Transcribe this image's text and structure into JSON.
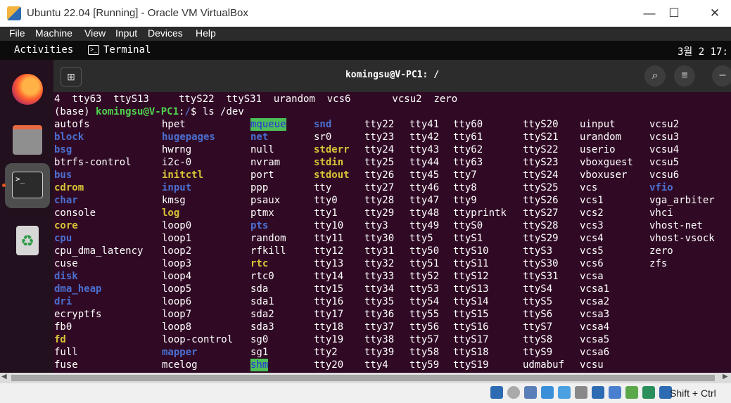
{
  "host_window": {
    "title": "Ubuntu 22.04 [Running] - Oracle VM VirtualBox",
    "controls": {
      "minimize": "—",
      "maximize": "☐",
      "close": "✕"
    },
    "menu": [
      "File",
      "Machine",
      "View",
      "Input",
      "Devices",
      "Help"
    ],
    "host_key": "Shift + Ctrl"
  },
  "ubuntu": {
    "activities": "Activities",
    "app_name": "Terminal",
    "clock": "3월 2 17:",
    "dock": [
      "firefox-icon",
      "files-icon",
      "terminal-icon",
      "trash-icon"
    ]
  },
  "terminal": {
    "title": "komingsu@V-PC1: /",
    "new_tab_glyph": "⊞",
    "search_glyph": "⌕",
    "menu_glyph": "≡",
    "close_glyph": "–",
    "first_line": "4  tty63  ttyS13     ttyS22  ttyS31  urandom  vcs6       vcsu2  zero",
    "prompt": {
      "env": "(base) ",
      "user": "komingsu@V-PC1",
      "sep": ":",
      "path": "/",
      "cmd": "$ ls /dev"
    },
    "columns": [
      [
        [
          "autofs",
          "r"
        ],
        [
          "block",
          "d"
        ],
        [
          "bsg",
          "d"
        ],
        [
          "btrfs-control",
          "r"
        ],
        [
          "bus",
          "d"
        ],
        [
          "cdrom",
          "dev"
        ],
        [
          "char",
          "d"
        ],
        [
          "console",
          "r"
        ],
        [
          "core",
          "dev"
        ],
        [
          "cpu",
          "d"
        ],
        [
          "cpu_dma_latency",
          "r"
        ],
        [
          "cuse",
          "r"
        ],
        [
          "disk",
          "d"
        ],
        [
          "dma_heap",
          "d"
        ],
        [
          "dri",
          "d"
        ],
        [
          "ecryptfs",
          "r"
        ],
        [
          "fb0",
          "r"
        ],
        [
          "fd",
          "dev"
        ],
        [
          "full",
          "r"
        ],
        [
          "fuse",
          "r"
        ]
      ],
      [
        [
          "hpet",
          "r"
        ],
        [
          "hugepages",
          "d"
        ],
        [
          "hwrng",
          "r"
        ],
        [
          "i2c-0",
          "r"
        ],
        [
          "initctl",
          "dev"
        ],
        [
          "input",
          "d"
        ],
        [
          "kmsg",
          "r"
        ],
        [
          "log",
          "dev"
        ],
        [
          "loop0",
          "r"
        ],
        [
          "loop1",
          "r"
        ],
        [
          "loop2",
          "r"
        ],
        [
          "loop3",
          "r"
        ],
        [
          "loop4",
          "r"
        ],
        [
          "loop5",
          "r"
        ],
        [
          "loop6",
          "r"
        ],
        [
          "loop7",
          "r"
        ],
        [
          "loop8",
          "r"
        ],
        [
          "loop-control",
          "r"
        ],
        [
          "mapper",
          "d"
        ],
        [
          "mcelog",
          "r"
        ]
      ],
      [
        [
          "mqueue",
          "hl"
        ],
        [
          "net",
          "d"
        ],
        [
          "null",
          "r"
        ],
        [
          "nvram",
          "r"
        ],
        [
          "port",
          "r"
        ],
        [
          "ppp",
          "r"
        ],
        [
          "psaux",
          "r"
        ],
        [
          "ptmx",
          "r"
        ],
        [
          "pts",
          "d"
        ],
        [
          "random",
          "r"
        ],
        [
          "rfkill",
          "r"
        ],
        [
          "rtc",
          "dev"
        ],
        [
          "rtc0",
          "r"
        ],
        [
          "sda",
          "r"
        ],
        [
          "sda1",
          "r"
        ],
        [
          "sda2",
          "r"
        ],
        [
          "sda3",
          "r"
        ],
        [
          "sg0",
          "r"
        ],
        [
          "sg1",
          "r"
        ],
        [
          "shm",
          "hl"
        ]
      ],
      [
        [
          "snd",
          "d"
        ],
        [
          "sr0",
          "r"
        ],
        [
          "stderr",
          "dev"
        ],
        [
          "stdin",
          "dev"
        ],
        [
          "stdout",
          "dev"
        ],
        [
          "tty",
          "r"
        ],
        [
          "tty0",
          "r"
        ],
        [
          "tty1",
          "r"
        ],
        [
          "tty10",
          "r"
        ],
        [
          "tty11",
          "r"
        ],
        [
          "tty12",
          "r"
        ],
        [
          "tty13",
          "r"
        ],
        [
          "tty14",
          "r"
        ],
        [
          "tty15",
          "r"
        ],
        [
          "tty16",
          "r"
        ],
        [
          "tty17",
          "r"
        ],
        [
          "tty18",
          "r"
        ],
        [
          "tty19",
          "r"
        ],
        [
          "tty2",
          "r"
        ],
        [
          "tty20",
          "r"
        ]
      ],
      [
        [
          "tty22",
          "r"
        ],
        [
          "tty23",
          "r"
        ],
        [
          "tty24",
          "r"
        ],
        [
          "tty25",
          "r"
        ],
        [
          "tty26",
          "r"
        ],
        [
          "tty27",
          "r"
        ],
        [
          "tty28",
          "r"
        ],
        [
          "tty29",
          "r"
        ],
        [
          "tty3",
          "r"
        ],
        [
          "tty30",
          "r"
        ],
        [
          "tty31",
          "r"
        ],
        [
          "tty32",
          "r"
        ],
        [
          "tty33",
          "r"
        ],
        [
          "tty34",
          "r"
        ],
        [
          "tty35",
          "r"
        ],
        [
          "tty36",
          "r"
        ],
        [
          "tty37",
          "r"
        ],
        [
          "tty38",
          "r"
        ],
        [
          "tty39",
          "r"
        ],
        [
          "tty4",
          "r"
        ]
      ],
      [
        [
          "tty41",
          "r"
        ],
        [
          "tty42",
          "r"
        ],
        [
          "tty43",
          "r"
        ],
        [
          "tty44",
          "r"
        ],
        [
          "tty45",
          "r"
        ],
        [
          "tty46",
          "r"
        ],
        [
          "tty47",
          "r"
        ],
        [
          "tty48",
          "r"
        ],
        [
          "tty49",
          "r"
        ],
        [
          "tty5",
          "r"
        ],
        [
          "tty50",
          "r"
        ],
        [
          "tty51",
          "r"
        ],
        [
          "tty52",
          "r"
        ],
        [
          "tty53",
          "r"
        ],
        [
          "tty54",
          "r"
        ],
        [
          "tty55",
          "r"
        ],
        [
          "tty56",
          "r"
        ],
        [
          "tty57",
          "r"
        ],
        [
          "tty58",
          "r"
        ],
        [
          "tty59",
          "r"
        ]
      ],
      [
        [
          "tty60",
          "r"
        ],
        [
          "tty61",
          "r"
        ],
        [
          "tty62",
          "r"
        ],
        [
          "tty63",
          "r"
        ],
        [
          "tty7",
          "r"
        ],
        [
          "tty8",
          "r"
        ],
        [
          "tty9",
          "r"
        ],
        [
          "ttyprintk",
          "r"
        ],
        [
          "ttyS0",
          "r"
        ],
        [
          "ttyS1",
          "r"
        ],
        [
          "ttyS10",
          "r"
        ],
        [
          "ttyS11",
          "r"
        ],
        [
          "ttyS12",
          "r"
        ],
        [
          "ttyS13",
          "r"
        ],
        [
          "ttyS14",
          "r"
        ],
        [
          "ttyS15",
          "r"
        ],
        [
          "ttyS16",
          "r"
        ],
        [
          "ttyS17",
          "r"
        ],
        [
          "ttyS18",
          "r"
        ],
        [
          "ttyS19",
          "r"
        ]
      ],
      [
        [
          "ttyS20",
          "r"
        ],
        [
          "ttyS21",
          "r"
        ],
        [
          "ttyS22",
          "r"
        ],
        [
          "ttyS23",
          "r"
        ],
        [
          "ttyS24",
          "r"
        ],
        [
          "ttyS25",
          "r"
        ],
        [
          "ttyS26",
          "r"
        ],
        [
          "ttyS27",
          "r"
        ],
        [
          "ttyS28",
          "r"
        ],
        [
          "ttyS29",
          "r"
        ],
        [
          "ttyS3",
          "r"
        ],
        [
          "ttyS30",
          "r"
        ],
        [
          "ttyS31",
          "r"
        ],
        [
          "ttyS4",
          "r"
        ],
        [
          "ttyS5",
          "r"
        ],
        [
          "ttyS6",
          "r"
        ],
        [
          "ttyS7",
          "r"
        ],
        [
          "ttyS8",
          "r"
        ],
        [
          "ttyS9",
          "r"
        ],
        [
          "udmabuf",
          "r"
        ]
      ],
      [
        [
          "uinput",
          "r"
        ],
        [
          "urandom",
          "r"
        ],
        [
          "userio",
          "r"
        ],
        [
          "vboxguest",
          "r"
        ],
        [
          "vboxuser",
          "r"
        ],
        [
          "vcs",
          "r"
        ],
        [
          "vcs1",
          "r"
        ],
        [
          "vcs2",
          "r"
        ],
        [
          "vcs3",
          "r"
        ],
        [
          "vcs4",
          "r"
        ],
        [
          "vcs5",
          "r"
        ],
        [
          "vcs6",
          "r"
        ],
        [
          "vcsa",
          "r"
        ],
        [
          "vcsa1",
          "r"
        ],
        [
          "vcsa2",
          "r"
        ],
        [
          "vcsa3",
          "r"
        ],
        [
          "vcsa4",
          "r"
        ],
        [
          "vcsa5",
          "r"
        ],
        [
          "vcsa6",
          "r"
        ],
        [
          "vcsu",
          "r"
        ]
      ],
      [
        [
          "vcsu2",
          "r"
        ],
        [
          "vcsu3",
          "r"
        ],
        [
          "vcsu4",
          "r"
        ],
        [
          "vcsu5",
          "r"
        ],
        [
          "vcsu6",
          "r"
        ],
        [
          "vfio",
          "d"
        ],
        [
          "vga_arbiter",
          "r"
        ],
        [
          "vhci",
          "r"
        ],
        [
          "vhost-net",
          "r"
        ],
        [
          "vhost-vsock",
          "r"
        ],
        [
          "zero",
          "r"
        ],
        [
          "zfs",
          "r"
        ]
      ]
    ]
  },
  "colors": {
    "terminal_bg": "#300a24",
    "directory": "#4a6fd1",
    "device": "#d8c437",
    "highlight_bg": "#4cbf58"
  }
}
